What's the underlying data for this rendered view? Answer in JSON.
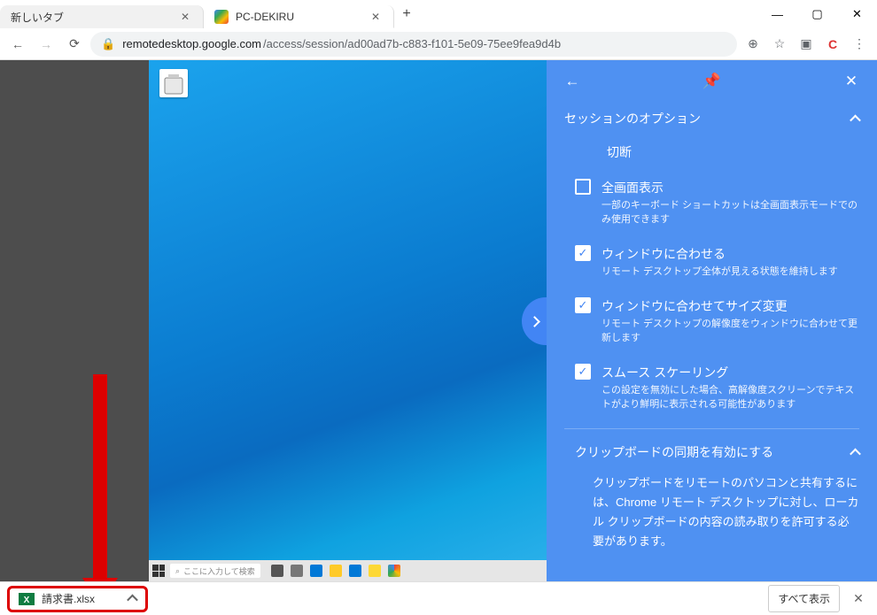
{
  "browser": {
    "tabs": [
      {
        "label": "新しいタブ",
        "active": false
      },
      {
        "label": "PC-DEKIRU",
        "active": true
      }
    ],
    "url": {
      "domain": "remotedesktop.google.com",
      "path": "/access/session/ad00ad7b-c883-f101-5e09-75ee9fea9d4b"
    }
  },
  "remote": {
    "search_placeholder": "ここに入力して検索"
  },
  "panel": {
    "section_title": "セッションのオプション",
    "disconnect": "切断",
    "opts": [
      {
        "checked": false,
        "title": "全画面表示",
        "desc": "一部のキーボード ショートカットは全画面表示モードでのみ使用できます"
      },
      {
        "checked": true,
        "title": "ウィンドウに合わせる",
        "desc": "リモート デスクトップ全体が見える状態を維持します"
      },
      {
        "checked": true,
        "title": "ウィンドウに合わせてサイズ変更",
        "desc": "リモート デスクトップの解像度をウィンドウに合わせて更新します"
      },
      {
        "checked": true,
        "title": "スムース スケーリング",
        "desc": "この設定を無効にした場合、高解像度スクリーンでテキストがより鮮明に表示される可能性があります"
      }
    ],
    "clipboard": {
      "title": "クリップボードの同期を有効にする",
      "body": "クリップボードをリモートのパソコンと共有するには、Chrome リモート デスクトップに対し、ローカル クリップボードの内容の読み取りを許可する必要があります。"
    }
  },
  "download": {
    "file": "請求書.xlsx",
    "show_all": "すべて表示"
  }
}
